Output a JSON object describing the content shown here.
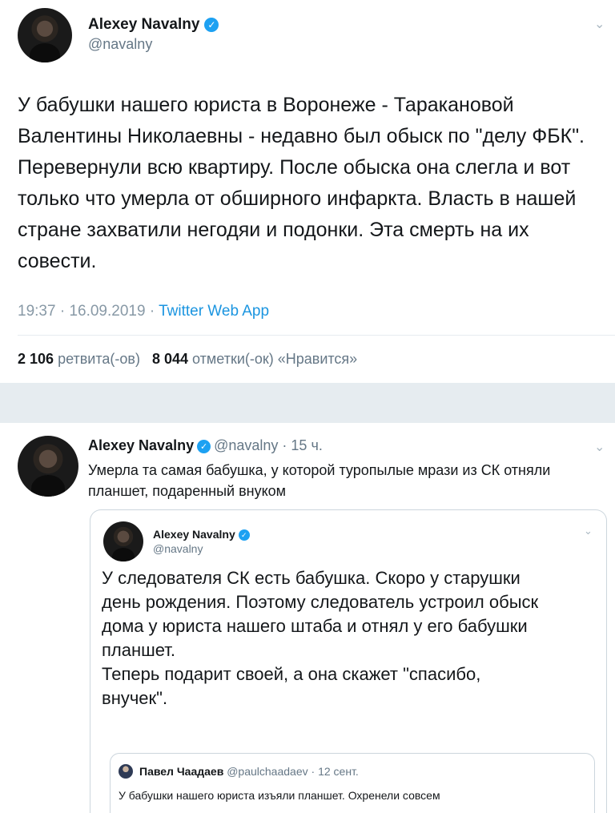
{
  "tweet1": {
    "name": "Alexey Navalny",
    "handle": "@navalny",
    "text": "У бабушки нашего юриста в Воронеже - Таракановой Валентины Николаевны - недавно был обыск по \"делу ФБК\". Перевернули всю квартиру. После обыска она слегла и вот только что умерла от обширного инфаркта. Власть в нашей стране захватили негодяи и подонки. Эта смерть на их совести.",
    "time": "19:37",
    "date": "16.09.2019",
    "source": "Twitter Web App",
    "retweets_count": "2 106",
    "retweets_label": "ретвита(-ов)",
    "likes_count": "8 044",
    "likes_label": "отметки(-ок) «Нравится»"
  },
  "tweet2": {
    "name": "Alexey Navalny",
    "handle": "@navalny",
    "age": "15 ч.",
    "text": "Умерла та самая бабушка, у которой туропылые мрази из СК отняли планшет, подаренный внуком"
  },
  "quoted": {
    "name": "Alexey Navalny",
    "handle": "@navalny",
    "text_lines": [
      "У следователя СК есть бабушка. Скоро у старушки",
      "день рождения. Поэтому следователь устроил обыск",
      "дома у юриста нашего штаба и отнял у его бабушки",
      "планшет.",
      "Теперь подарит своей, а она скажет \"спасибо,",
      "внучек\"."
    ]
  },
  "nested_quote": {
    "name": "Павел Чаадаев",
    "handle": "@paulchaadaev",
    "age": "12 сент.",
    "text": "У бабушки нашего юриста изъяли планшет. Охренели совсем"
  },
  "icons": {
    "verified": "verified-badge-icon",
    "chevron": "chevron-down-icon"
  },
  "colors": {
    "accent": "#1da1f2",
    "link": "#1b95e0",
    "muted": "#657786",
    "divider": "#e6ecf0"
  }
}
